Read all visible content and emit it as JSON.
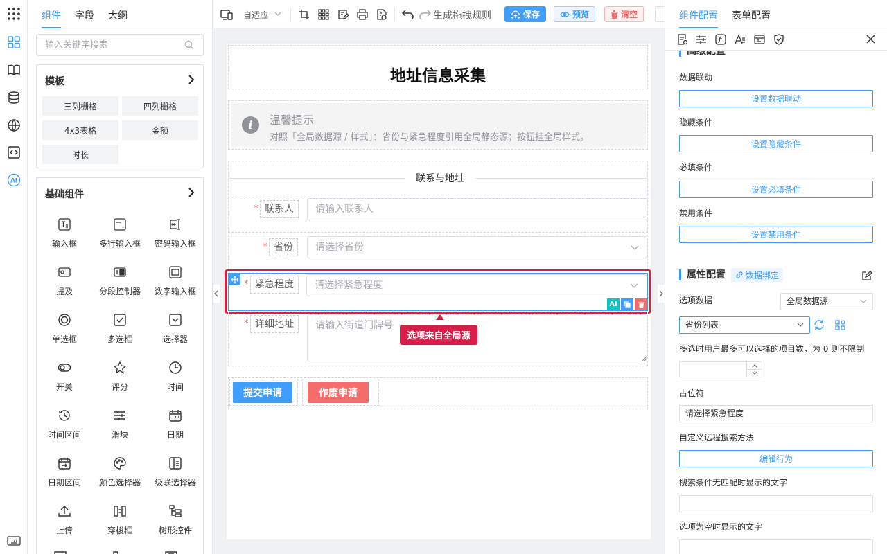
{
  "rail": {
    "icons": [
      "apps-grid-icon",
      "components-icon",
      "book-icon",
      "database-icon",
      "globe-icon",
      "code-icon",
      "ai-icon",
      "keyboard-icon"
    ],
    "ai_label": "AI"
  },
  "left_panel": {
    "tabs": [
      "组件",
      "字段",
      "大纲"
    ],
    "search_placeholder": "输入关键字搜索",
    "templates": {
      "title": "模板",
      "items": [
        "三列栅格",
        "四列栅格",
        "4x3表格",
        "金额",
        "时长"
      ]
    },
    "basic": {
      "title": "基础组件",
      "items": [
        "输入框",
        "多行输入框",
        "密码输入框",
        "提及",
        "分段控制器",
        "数字输入框",
        "单选框",
        "多选框",
        "选择器",
        "开关",
        "评分",
        "时间",
        "时间区间",
        "滑块",
        "日期",
        "日期区间",
        "颜色选择器",
        "级联选择器",
        "上传",
        "穿梭框",
        "树形控件"
      ]
    }
  },
  "toolbar": {
    "layout_mode": "自适应",
    "rule_label": "生成拖拽规则",
    "save": "保存",
    "preview": "预览",
    "clear": "清空"
  },
  "form": {
    "title": "地址信息采集",
    "alert": {
      "title": "温馨提示",
      "text": "对照「全局数据源 / 样式」：省份与紧急程度引用全局静态源；按钮挂全局样式。"
    },
    "divider": "联系与地址",
    "fields": [
      {
        "label": "联系人",
        "placeholder": "请输入联系人",
        "type": "input"
      },
      {
        "label": "省份",
        "placeholder": "请选择省份",
        "type": "select"
      },
      {
        "label": "紧急程度",
        "placeholder": "请选择紧急程度",
        "type": "select"
      },
      {
        "label": "详细地址",
        "placeholder": "请输入街道门牌号",
        "type": "textarea"
      }
    ],
    "tooltip": "选项来自全局源",
    "submit": "提交申请",
    "void": "作废申请",
    "ai_tool": "AI"
  },
  "right_panel": {
    "tabs": [
      "组件配置",
      "表单配置"
    ],
    "advanced_title": "高级配置",
    "rows": [
      {
        "label": "数据联动",
        "button": "设置数据联动"
      },
      {
        "label": "隐藏条件",
        "button": "设置隐藏条件"
      },
      {
        "label": "必填条件",
        "button": "设置必填条件"
      },
      {
        "label": "禁用条件",
        "button": "设置禁用条件"
      }
    ],
    "prop_title": "属性配置",
    "bind_label": "数据绑定",
    "options_label": "选项数据",
    "options_source": "全局数据源",
    "options_list": "省份列表",
    "multi_limit_label": "多选时用户最多可以选择的项目数，为 0 则不限制",
    "multi_limit_value": "",
    "placeholder_label": "占位符",
    "placeholder_value": "请选择紧急程度",
    "remote_label": "自定义远程搜索方法",
    "remote_button": "编辑行为",
    "nomatch_label": "搜索条件无匹配时显示的文字",
    "nomatch_value": "",
    "empty_label": "选项为空时显示的文字",
    "empty_value": ""
  },
  "colors": {
    "primary": "#409eff",
    "danger": "#f56c6c",
    "highlight": "#d81e47",
    "canvas_bg": "#f0f1f3"
  }
}
